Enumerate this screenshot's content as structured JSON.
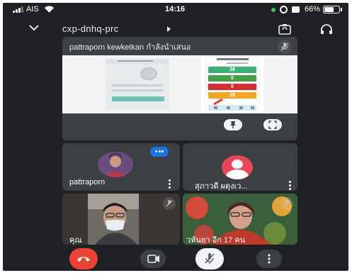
{
  "status_bar": {
    "carrier": "AIS",
    "time": "14:16",
    "battery_percent": "66%",
    "battery_level": 0.66,
    "signal_bars": 3,
    "icons": [
      "wifi-icon",
      "active-call-dot",
      "alarm-icon",
      "screen-record-icon",
      "battery-charging-icon"
    ]
  },
  "meeting": {
    "code": "cxp-dnhq-prc",
    "back_icon": "chevron-down-icon",
    "camera_switch_icon": "camera-switch-icon",
    "audio_icon": "headphones-icon"
  },
  "presentation": {
    "title": "pattraporn kewketkan กำลังนำเสนอ",
    "mic_icon": "mic-off-icon",
    "pin_icon": "pin-icon",
    "fullscreen_icon": "fullscreen-icon",
    "shared_values": [
      "28",
      "0",
      "0",
      "28"
    ],
    "shared_colors": [
      "#3cb07a",
      "#43a047",
      "#d32f2f",
      "#f5a623"
    ]
  },
  "participants": [
    {
      "name": "pattraporn",
      "speaking": true,
      "menu_icon": "more-vert-icon"
    },
    {
      "name": "สุภาวดี ผดุงเว...",
      "avatar_color": "#e8455c",
      "menu_icon": "more-vert-icon"
    },
    {
      "name": "คุณ",
      "muted": true
    },
    {
      "name": "วหันยา   อีก 17 คน",
      "muted": true
    }
  ],
  "controls": {
    "end_call_icon": "call-end-icon",
    "camera_icon": "videocam-icon",
    "mic_icon": "mic-off-icon",
    "more_icon": "more-vert-icon",
    "colors": {
      "end_call": "#ea4335",
      "accent": "#1a73e8",
      "background": "#202124",
      "tile": "#3c4043"
    }
  }
}
